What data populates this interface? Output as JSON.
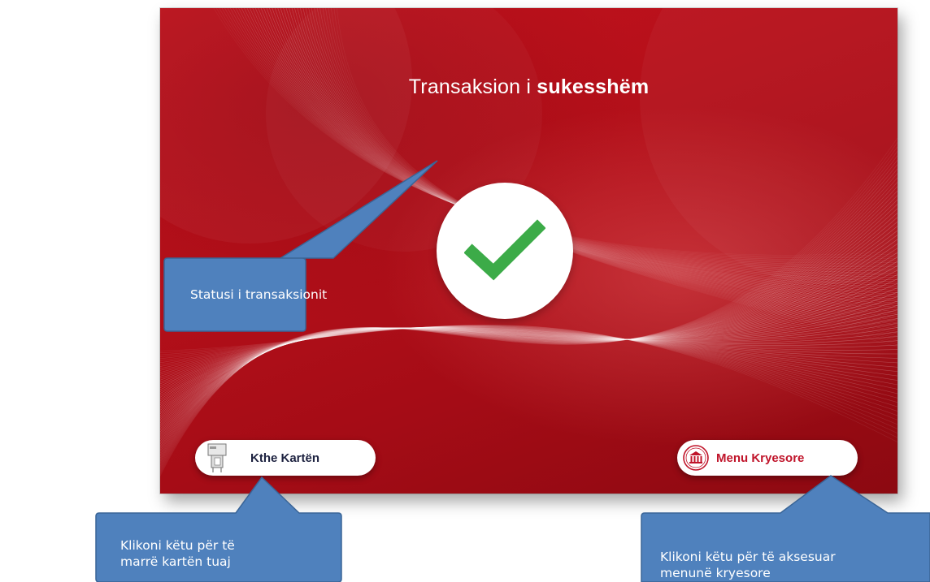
{
  "screen": {
    "title_regular": "Transaksion i ",
    "title_bold": "sukesshëm",
    "status_icon": "checkmark-icon",
    "colors": {
      "background": "#b5101a",
      "check": "#3cab48",
      "button_menu_text": "#c0142a",
      "button_card_text": "#1d2240"
    },
    "buttons": {
      "return_card": {
        "label": "Kthe Kartën",
        "icon": "card-return-icon"
      },
      "main_menu": {
        "label": "Menu Kryesore",
        "icon": "bank-icon"
      }
    }
  },
  "callouts": {
    "status": {
      "text": "Statusi i transaksionit"
    },
    "card": {
      "line1": "Klikoni këtu për të",
      "line2": "marrë kartën tuaj"
    },
    "menu": {
      "line1": "Klikoni këtu për të aksesuar",
      "line2": "menunë kryesore"
    }
  },
  "colors": {
    "callout_fill": "#4f81bd",
    "callout_border": "#3a6597"
  }
}
